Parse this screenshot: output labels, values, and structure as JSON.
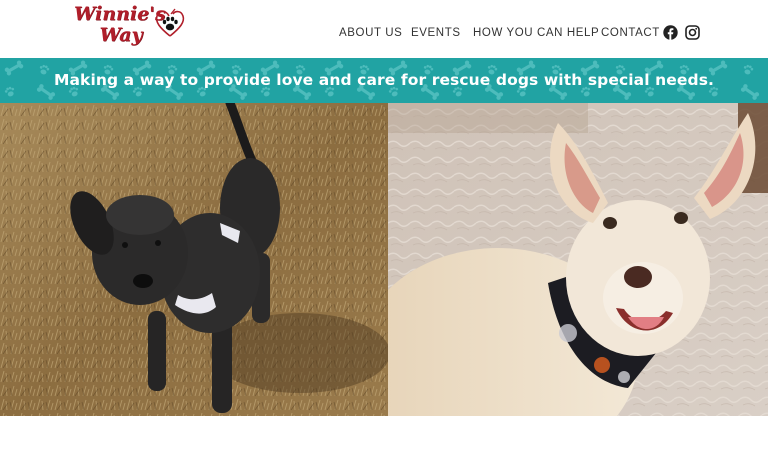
{
  "logo": {
    "line1": "Winnie's",
    "line2": "Way"
  },
  "nav": {
    "items": [
      {
        "label": "ABOUT US"
      },
      {
        "label": "EVENTS"
      },
      {
        "label": "HOW YOU CAN HELP"
      },
      {
        "label": "CONTACT"
      }
    ],
    "social": [
      "facebook-icon",
      "instagram-icon"
    ]
  },
  "banner": {
    "tagline": "Making a way to provide love and care for rescue dogs with special needs."
  },
  "colors": {
    "brand_red": "#b01e2a",
    "banner_teal": "#21a3a3",
    "nav_text": "#333333"
  },
  "photos": [
    {
      "description_icon": "black-dog-photo"
    },
    {
      "description_icon": "cream-dog-photo"
    }
  ]
}
